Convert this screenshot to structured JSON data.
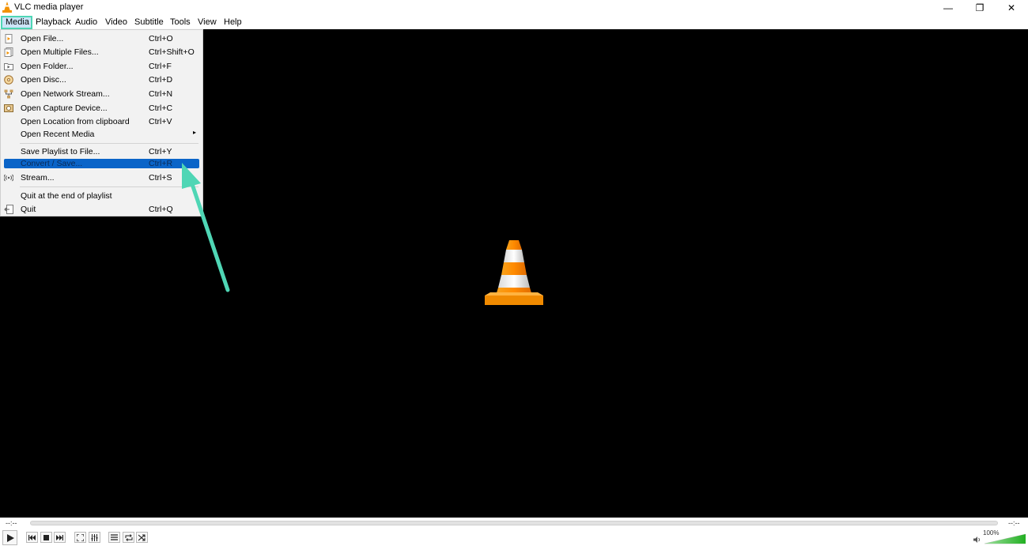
{
  "window": {
    "title": "VLC media player",
    "controls": {
      "minimize": "—",
      "maximize": "❐",
      "close": "✕"
    }
  },
  "menubar": {
    "items": [
      "Media",
      "Playback",
      "Audio",
      "Video",
      "Subtitle",
      "Tools",
      "View",
      "Help"
    ],
    "active": "Media"
  },
  "media_menu": {
    "items": [
      {
        "label": "Open File...",
        "shortcut": "Ctrl+O",
        "icon": "file-icon"
      },
      {
        "label": "Open Multiple Files...",
        "shortcut": "Ctrl+Shift+O",
        "icon": "multiple-files-icon"
      },
      {
        "label": "Open Folder...",
        "shortcut": "Ctrl+F",
        "icon": "folder-icon"
      },
      {
        "label": "Open Disc...",
        "shortcut": "Ctrl+D",
        "icon": "disc-icon"
      },
      {
        "label": "Open Network Stream...",
        "shortcut": "Ctrl+N",
        "icon": "network-icon"
      },
      {
        "label": "Open Capture Device...",
        "shortcut": "Ctrl+C",
        "icon": "capture-device-icon"
      },
      {
        "label": "Open Location from clipboard",
        "shortcut": "Ctrl+V",
        "icon": ""
      },
      {
        "label": "Open Recent Media",
        "shortcut": "",
        "icon": "",
        "submenu": "▸"
      },
      {
        "label": "Save Playlist to File...",
        "shortcut": "Ctrl+Y",
        "icon": ""
      },
      {
        "label": "Convert / Save...",
        "shortcut": "Ctrl+R",
        "icon": "",
        "selected": true
      },
      {
        "label": "Stream...",
        "shortcut": "Ctrl+S",
        "icon": "stream-icon"
      },
      {
        "label": "Quit at the end of playlist",
        "shortcut": "",
        "icon": ""
      },
      {
        "label": "Quit",
        "shortcut": "Ctrl+Q",
        "icon": "quit-icon"
      }
    ]
  },
  "player": {
    "time_elapsed": "--:--",
    "time_total": "--:--",
    "volume": "100%",
    "volume_level": 1.0
  },
  "colors": {
    "highlight": "#4fd6b5",
    "selected_item": "#0a64c8",
    "cone_orange": "#f39200"
  }
}
